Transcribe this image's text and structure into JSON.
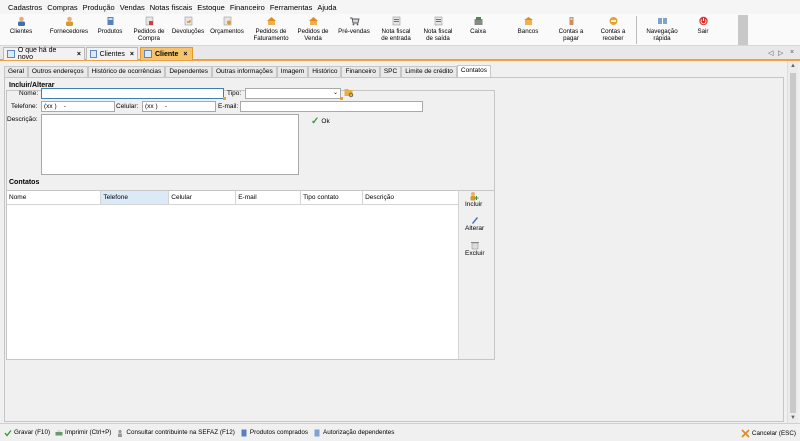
{
  "menu": [
    "Cadastros",
    "Compras",
    "Produção",
    "Vendas",
    "Notas fiscais",
    "Estoque",
    "Financeiro",
    "Ferramentas",
    "Ajuda"
  ],
  "toolbar": [
    {
      "icon": "person-icon",
      "label": "Clientes"
    },
    {
      "icon": "person-icon",
      "label": "Fornecedores"
    },
    {
      "icon": "box-icon",
      "label": "Produtos"
    },
    {
      "icon": "order-icon",
      "label": "Pedidos de\nCompra"
    },
    {
      "icon": "return-icon",
      "label": "Devoluções"
    },
    {
      "icon": "quote-icon",
      "label": "Orçamentos"
    },
    {
      "icon": "order-icon",
      "label": "Pedidos de\nFaturamento"
    },
    {
      "icon": "order-icon",
      "label": "Pedidos de\nVenda"
    },
    {
      "icon": "cart-icon",
      "label": "Pré-vendas"
    },
    {
      "icon": "invoice-icon",
      "label": "Nota fiscal\nde entrada"
    },
    {
      "icon": "invoice-icon",
      "label": "Nota fiscal\nde saída"
    },
    {
      "icon": "cash-icon",
      "label": "Caixa"
    },
    {
      "icon": "bank-icon",
      "label": "Bancos"
    },
    {
      "icon": "payable-icon",
      "label": "Contas a\npagar"
    },
    {
      "icon": "receivable-icon",
      "label": "Contas a\nreceber"
    },
    {
      "icon": "navigation-icon",
      "label": "Navegação\nrápida"
    },
    {
      "icon": "power-icon",
      "label": "Sair"
    }
  ],
  "doc_tabs": [
    {
      "label": "O que há de novo",
      "active": false
    },
    {
      "label": "Clientes",
      "active": false
    },
    {
      "label": "Cliente",
      "active": true
    }
  ],
  "sub_tabs": [
    "Geral",
    "Outros endereços",
    "Histórico de ocorrências",
    "Dependentes",
    "Outras informações",
    "Imagem",
    "Histórico",
    "Financeiro",
    "SPC",
    "Limite de crédito",
    "Contatos"
  ],
  "active_sub_tab": "Contatos",
  "form": {
    "group_title": "Incluir/Alterar",
    "nome_label": "Nome:",
    "nome_value": "",
    "tipo_label": "Tipo:",
    "tipo_value": "",
    "telefone_label": "Telefone:",
    "telefone_mask": "(xx )    -",
    "celular_label": "Celular:",
    "celular_mask": "(xx )    -",
    "email_label": "E-mail:",
    "descricao_label": "Descrição:",
    "ok_label": "Ok"
  },
  "contatos": {
    "group_title": "Contatos",
    "columns": [
      "Nome",
      "Telefone",
      "Celular",
      "E-mail",
      "Tipo contato",
      "Descrição"
    ],
    "selected_column": "Telefone",
    "actions": [
      "Incluir",
      "Alterar",
      "Excluir"
    ]
  },
  "status_actions": [
    "Gravar (F10)",
    "Imprimir (Ctrl+P)",
    "Consultar contribuinte na SEFAZ (F12)",
    "Produtos comprados",
    "Autorização dependentes"
  ],
  "cancel_label": "Cancelar (ESC)",
  "colors": {
    "accent": "#f0a040",
    "active_tab": "#f6c46c",
    "selection": "#dce9f7",
    "focus": "#3c7fb1"
  }
}
